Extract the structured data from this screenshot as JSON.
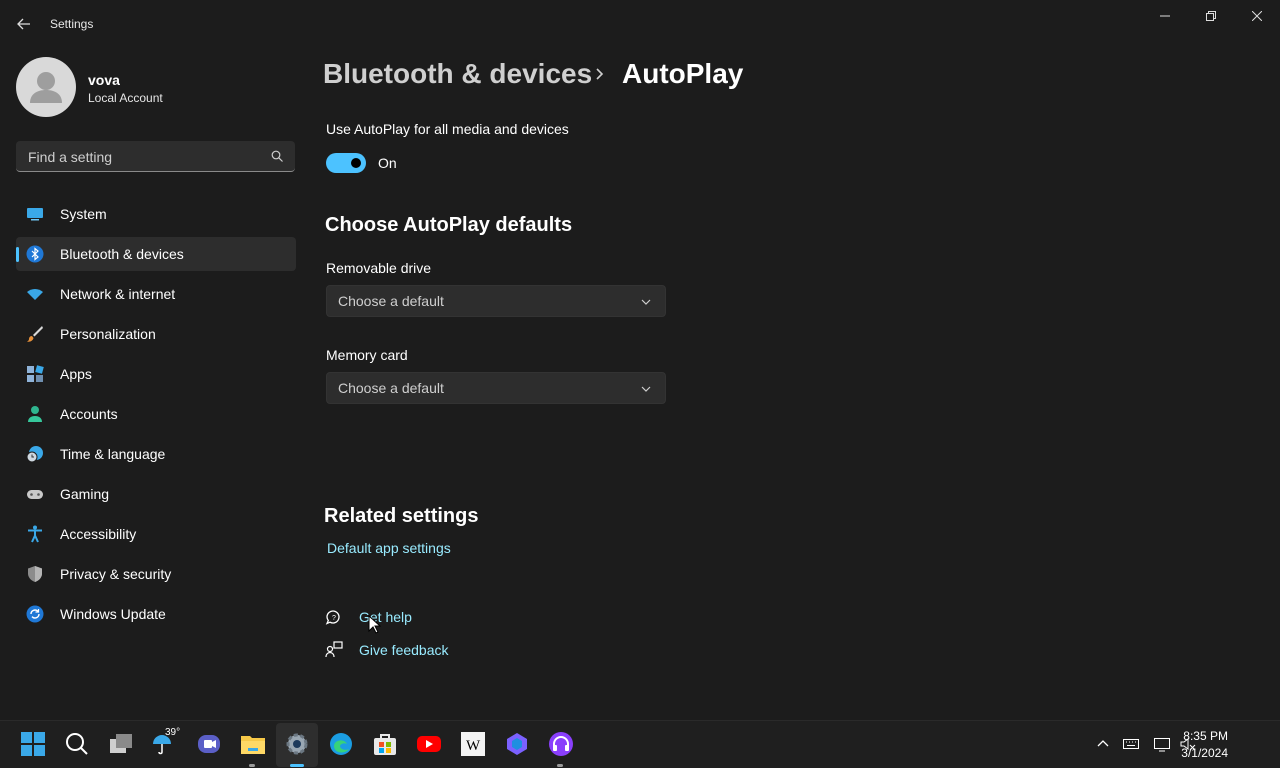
{
  "window": {
    "title": "Settings",
    "controls": [
      "minimize",
      "restore",
      "close"
    ]
  },
  "user": {
    "name": "vova",
    "account_type": "Local Account"
  },
  "search": {
    "placeholder": "Find a setting"
  },
  "nav": {
    "items": [
      {
        "label": "System",
        "icon": "system-icon",
        "selected": false
      },
      {
        "label": "Bluetooth & devices",
        "icon": "bluetooth-icon",
        "selected": true
      },
      {
        "label": "Network & internet",
        "icon": "wifi-icon",
        "selected": false
      },
      {
        "label": "Personalization",
        "icon": "brush-icon",
        "selected": false
      },
      {
        "label": "Apps",
        "icon": "apps-icon",
        "selected": false
      },
      {
        "label": "Accounts",
        "icon": "person-icon",
        "selected": false
      },
      {
        "label": "Time & language",
        "icon": "globe-clock-icon",
        "selected": false
      },
      {
        "label": "Gaming",
        "icon": "gamepad-icon",
        "selected": false
      },
      {
        "label": "Accessibility",
        "icon": "accessibility-icon",
        "selected": false
      },
      {
        "label": "Privacy & security",
        "icon": "shield-icon",
        "selected": false
      },
      {
        "label": "Windows Update",
        "icon": "update-icon",
        "selected": false
      }
    ]
  },
  "breadcrumb": {
    "parent": "Bluetooth & devices",
    "current": "AutoPlay"
  },
  "autoplay": {
    "toggle_label": "Use AutoPlay for all media and devices",
    "toggle_state": "On",
    "toggle_on": true
  },
  "defaults": {
    "title": "Choose AutoPlay defaults",
    "removable_label": "Removable drive",
    "removable_value": "Choose a default",
    "memory_label": "Memory card",
    "memory_value": "Choose a default"
  },
  "related": {
    "title": "Related settings",
    "default_apps_link": "Default app settings"
  },
  "help": {
    "get_help": "Get help",
    "give_feedback": "Give feedback"
  },
  "taskbar": {
    "weather_temp": "39°",
    "apps": [
      "start-icon",
      "search-icon",
      "task-view-icon",
      "weather-icon",
      "teams-icon",
      "file-explorer-icon",
      "settings-icon",
      "edge-icon",
      "store-icon",
      "youtube-icon",
      "wikipedia-icon",
      "copilot-icon",
      "headphones-app-icon"
    ],
    "time": "8:35 PM",
    "date": "3/1/2024"
  },
  "colors": {
    "accent": "#4cc2ff",
    "link": "#99ebff",
    "background": "#1c1c1c",
    "surface": "#2d2d2d"
  }
}
